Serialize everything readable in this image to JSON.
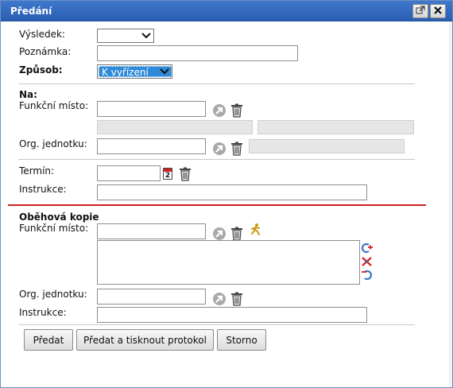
{
  "window": {
    "title": "Předání"
  },
  "titlebar": {
    "popout_icon": "popout-icon",
    "close_icon": "close-icon"
  },
  "form": {
    "vysledek_label": "Výsledek:",
    "vysledek_value": "",
    "poznamka_label": "Poznámka:",
    "poznamka_value": "",
    "zpusob_label": "Způsob:",
    "zpusob_value": "K vyřízení"
  },
  "na": {
    "heading": "Na:",
    "funkcni_misto_label": "Funkční místo:",
    "funkcni_misto_value": "",
    "org_jednotku_label": "Org. jednotku:",
    "org_jednotku_value": "",
    "termin_label": "Termín:",
    "termin_value": "",
    "calendar_day": "2",
    "instrukce_label": "Instrukce:",
    "instrukce_value": ""
  },
  "obehova_kopie": {
    "heading": "Oběhová kopie",
    "funkcni_misto_label": "Funkční místo:",
    "funkcni_misto_value": "",
    "org_jednotku_label": "Org. jednotku:",
    "org_jednotku_value": "",
    "instrukce_label": "Instrukce:",
    "instrukce_value": ""
  },
  "buttons": {
    "predat": "Předat",
    "predat_tisk": "Předat a tisknout protokol",
    "storno": "Storno"
  },
  "colors": {
    "titlebar": "#2f66bd",
    "separator_red": "#cc2020",
    "select_highlight": "#2e8ad8"
  }
}
